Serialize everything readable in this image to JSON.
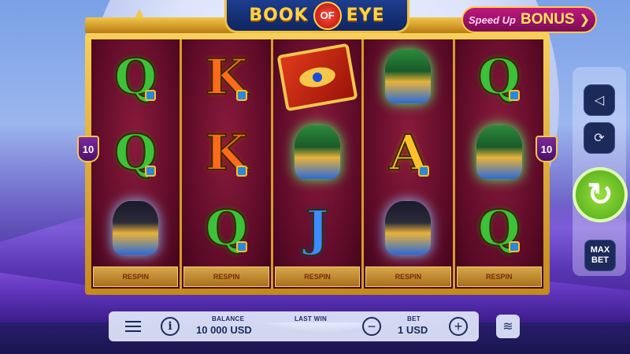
{
  "game": {
    "logo_word_1": "BOOK",
    "logo_of": "OF",
    "logo_word_2": "EYE"
  },
  "bonus_button": {
    "speed_label": "Speed Up",
    "bonus_label": "BONUS",
    "arrow": "❯"
  },
  "lines": {
    "left_badge": "10",
    "right_badge": "10"
  },
  "reels": [
    {
      "symbols": [
        "Q",
        "Q",
        "anubis"
      ],
      "respin_label": "RESPIN"
    },
    {
      "symbols": [
        "K",
        "K",
        "Q"
      ],
      "respin_label": "RESPIN"
    },
    {
      "symbols": [
        "book",
        "horus",
        "J"
      ],
      "respin_label": "RESPIN"
    },
    {
      "symbols": [
        "horus",
        "A",
        "anubis"
      ],
      "respin_label": "RESPIN"
    },
    {
      "symbols": [
        "Q",
        "horus",
        "Q"
      ],
      "respin_label": "RESPIN"
    }
  ],
  "side_controls": {
    "sound_icon": "◁",
    "autoplay_icon": "⟳",
    "spin_icon": "↻",
    "max_bet_line1": "MAX",
    "max_bet_line2": "BET"
  },
  "bottom_bar": {
    "menu_icon": "hamburger-icon",
    "info_icon": "i",
    "balance_label": "BALANCE",
    "balance_value": "10 000 USD",
    "last_win_label": "LAST WIN",
    "last_win_value": "",
    "bet_label": "BET",
    "bet_value": "1 USD",
    "minus": "−",
    "plus": "+",
    "coins_icon": "≋"
  }
}
